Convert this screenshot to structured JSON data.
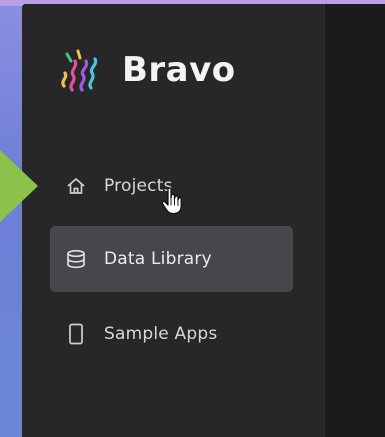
{
  "app": {
    "brand": "Bravo"
  },
  "sidebar": {
    "items": [
      {
        "label": "Projects",
        "icon": "home-icon",
        "active": false
      },
      {
        "label": "Data Library",
        "icon": "database-icon",
        "active": true
      },
      {
        "label": "Sample Apps",
        "icon": "mobile-device-icon",
        "active": false
      }
    ]
  },
  "colors": {
    "sidebar_bg": "#27272a",
    "active_item_bg": "#47474b",
    "arrow": "#8bc34a",
    "desktop_bg": "#6f7fd3"
  }
}
